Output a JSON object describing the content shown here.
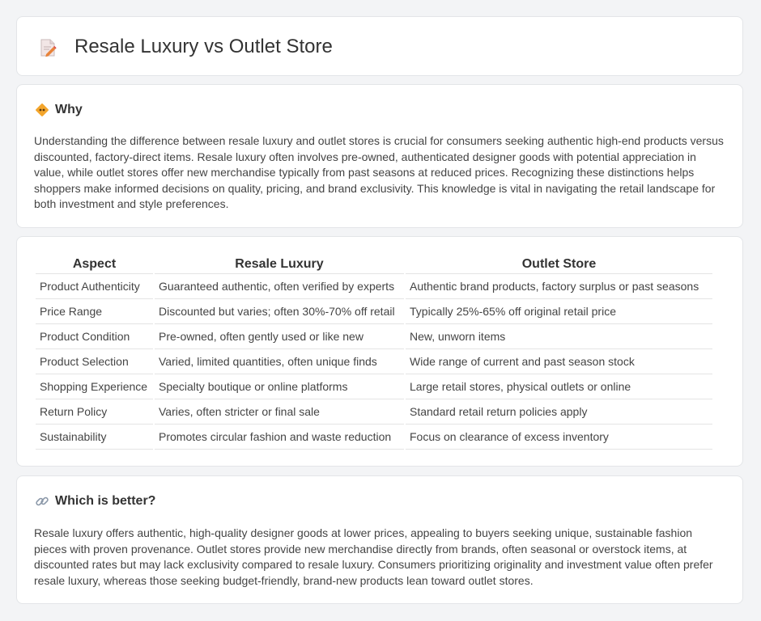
{
  "header": {
    "title": "Resale Luxury vs Outlet Store",
    "icon": "document-pencil-icon"
  },
  "why": {
    "icon": "diamond-sign-icon",
    "heading": "Why",
    "text": "Understanding the difference between resale luxury and outlet stores is crucial for consumers seeking authentic high-end products versus discounted, factory-direct items. Resale luxury often involves pre-owned, authenticated designer goods with potential appreciation in value, while outlet stores offer new merchandise typically from past seasons at reduced prices. Recognizing these distinctions helps shoppers make informed decisions on quality, pricing, and brand exclusivity. This knowledge is vital in navigating the retail landscape for both investment and style preferences."
  },
  "comparison": {
    "headers": [
      "Aspect",
      "Resale Luxury",
      "Outlet Store"
    ],
    "rows": [
      [
        "Product Authenticity",
        "Guaranteed authentic, often verified by experts",
        "Authentic brand products, factory surplus or past seasons"
      ],
      [
        "Price Range",
        "Discounted but varies; often 30%-70% off retail",
        "Typically 25%-65% off original retail price"
      ],
      [
        "Product Condition",
        "Pre-owned, often gently used or like new",
        "New, unworn items"
      ],
      [
        "Product Selection",
        "Varied, limited quantities, often unique finds",
        "Wide range of current and past season stock"
      ],
      [
        "Shopping Experience",
        "Specialty boutique or online platforms",
        "Large retail stores, physical outlets or online"
      ],
      [
        "Return Policy",
        "Varies, often stricter or final sale",
        "Standard retail return policies apply"
      ],
      [
        "Sustainability",
        "Promotes circular fashion and waste reduction",
        "Focus on clearance of excess inventory"
      ]
    ]
  },
  "better": {
    "icon": "link-icon",
    "heading": "Which is better?",
    "text": "Resale luxury offers authentic, high-quality designer goods at lower prices, appealing to buyers seeking unique, sustainable fashion pieces with proven provenance. Outlet stores provide new merchandise directly from brands, often seasonal or overstock items, at discounted rates but may lack exclusivity compared to resale luxury. Consumers prioritizing originality and investment value often prefer resale luxury, whereas those seeking budget-friendly, brand-new products lean toward outlet stores."
  }
}
